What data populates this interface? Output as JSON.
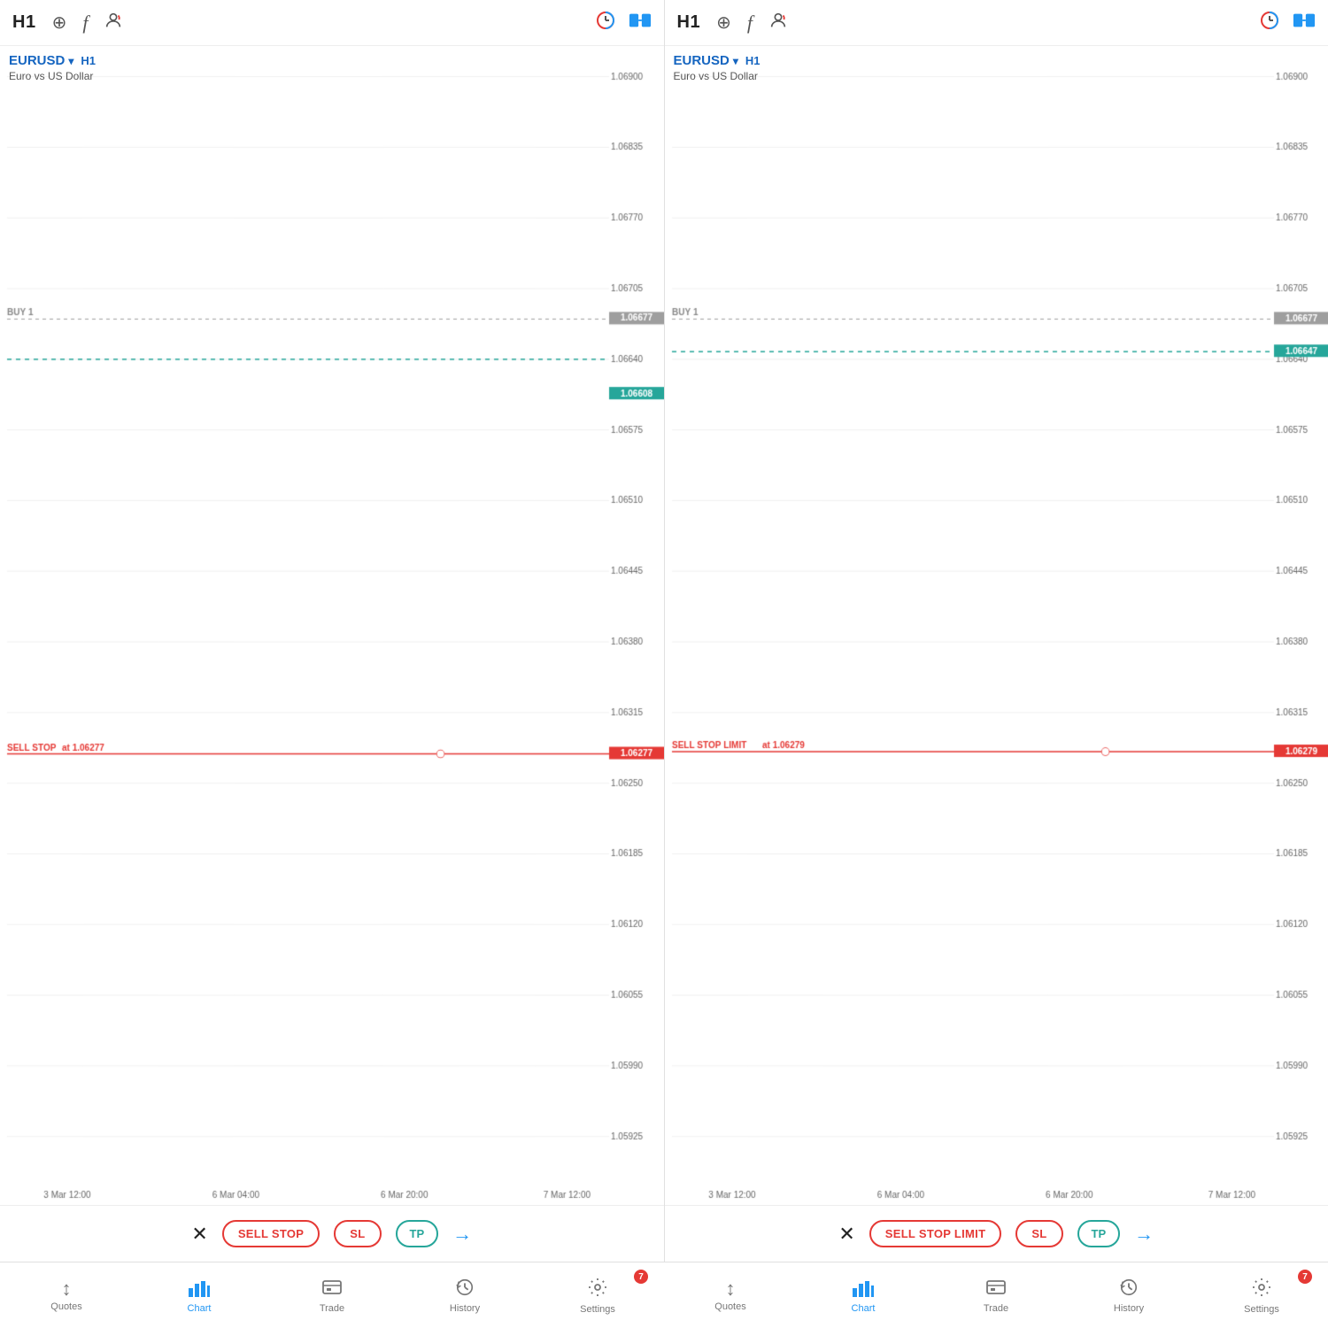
{
  "panels": [
    {
      "id": "panel-left",
      "toolbar": {
        "timeframe": "H1",
        "icons": [
          "crosshair",
          "f",
          "person"
        ],
        "right_icons": [
          "clock-blue",
          "link-blue"
        ]
      },
      "chart": {
        "symbol": "EURUSD",
        "timeframe": "H1",
        "description": "Euro vs US Dollar",
        "price_levels": [
          {
            "value": "1.06900",
            "pct": 5
          },
          {
            "value": "1.06835",
            "pct": 13
          },
          {
            "value": "1.06770",
            "pct": 21
          },
          {
            "value": "1.06705",
            "pct": 29
          },
          {
            "value": "1.06677",
            "pct": 33
          },
          {
            "value": "1.06640",
            "pct": 38
          },
          {
            "value": "1.06608",
            "pct": 42
          },
          {
            "value": "1.06575",
            "pct": 46
          },
          {
            "value": "1.06510",
            "pct": 54
          },
          {
            "value": "1.06445",
            "pct": 62
          },
          {
            "value": "1.06380",
            "pct": 70
          },
          {
            "value": "1.06315",
            "pct": 78
          },
          {
            "value": "1.06277",
            "pct": 83
          },
          {
            "value": "1.06250",
            "pct": 86
          },
          {
            "value": "1.06185",
            "pct": 91
          },
          {
            "value": "1.06120",
            "pct": 96
          },
          {
            "value": "1.06055",
            "pct": 101
          },
          {
            "value": "1.05990",
            "pct": 106
          },
          {
            "value": "1.05925",
            "pct": 111
          }
        ],
        "time_labels": [
          {
            "label": "3 Mar 12:00",
            "pct": 10
          },
          {
            "label": "6 Mar 04:00",
            "pct": 38
          },
          {
            "label": "6 Mar 20:00",
            "pct": 66
          },
          {
            "label": "7 Mar 12:00",
            "pct": 92
          }
        ],
        "current_price": "1.06608",
        "order_lines": [
          {
            "type": "sell_stop",
            "label": "SELL STOP",
            "at_label": "at 1.06277",
            "price": "1.06277",
            "pct_y": 83
          },
          {
            "type": "buy",
            "label": "BUY 1",
            "price": "1.06677",
            "pct_y": 33
          }
        ],
        "dotted_line_pct": 38,
        "current_price_pct": 42
      },
      "action_bar": {
        "close_icon": "×",
        "order_button": "SELL STOP",
        "sl_button": "SL",
        "tp_button": "TP",
        "arrow": "→"
      }
    },
    {
      "id": "panel-right",
      "toolbar": {
        "timeframe": "H1",
        "icons": [
          "crosshair",
          "f",
          "person"
        ],
        "right_icons": [
          "clock-blue",
          "link-blue"
        ]
      },
      "chart": {
        "symbol": "EURUSD",
        "timeframe": "H1",
        "description": "Euro vs US Dollar",
        "price_levels": [
          {
            "value": "1.06900",
            "pct": 5
          },
          {
            "value": "1.06835",
            "pct": 13
          },
          {
            "value": "1.06770",
            "pct": 21
          },
          {
            "value": "1.06705",
            "pct": 29
          },
          {
            "value": "1.06677",
            "pct": 33
          },
          {
            "value": "1.06647",
            "pct": 37
          },
          {
            "value": "1.06640",
            "pct": 38
          },
          {
            "value": "1.06575",
            "pct": 46
          },
          {
            "value": "1.06510",
            "pct": 54
          },
          {
            "value": "1.06445",
            "pct": 62
          },
          {
            "value": "1.06380",
            "pct": 70
          },
          {
            "value": "1.06315",
            "pct": 78
          },
          {
            "value": "1.06279",
            "pct": 83
          },
          {
            "value": "1.06250",
            "pct": 86
          },
          {
            "value": "1.06185",
            "pct": 91
          },
          {
            "value": "1.06120",
            "pct": 96
          },
          {
            "value": "1.06055",
            "pct": 101
          },
          {
            "value": "1.05990",
            "pct": 106
          },
          {
            "value": "1.05925",
            "pct": 111
          }
        ],
        "time_labels": [
          {
            "label": "3 Mar 12:00",
            "pct": 10
          },
          {
            "label": "6 Mar 04:00",
            "pct": 38
          },
          {
            "label": "6 Mar 20:00",
            "pct": 66
          },
          {
            "label": "7 Mar 12:00",
            "pct": 92
          }
        ],
        "current_price": "1.06647",
        "order_lines": [
          {
            "type": "sell_stop_limit",
            "label": "SELL STOP LIMIT",
            "at_label": "at 1.06279",
            "price": "1.06279",
            "pct_y": 83
          },
          {
            "type": "buy",
            "label": "BUY 1",
            "price": "1.06677",
            "pct_y": 33
          }
        ],
        "dotted_line_pct": 37,
        "current_price_pct": 37
      },
      "action_bar": {
        "close_icon": "×",
        "order_button": "SELL STOP LIMIT",
        "sl_button": "SL",
        "tp_button": "TP",
        "arrow": "→"
      }
    }
  ],
  "bottom_nav": {
    "items": [
      {
        "id": "quotes",
        "label": "Quotes",
        "icon": "↕",
        "active": false
      },
      {
        "id": "chart",
        "label": "Chart",
        "icon": "chart",
        "active": true
      },
      {
        "id": "trade",
        "label": "Trade",
        "icon": "trade",
        "active": false
      },
      {
        "id": "history",
        "label": "History",
        "icon": "history",
        "active": false
      },
      {
        "id": "settings",
        "label": "Settings",
        "icon": "gear",
        "active": false,
        "badge": "7"
      }
    ]
  }
}
